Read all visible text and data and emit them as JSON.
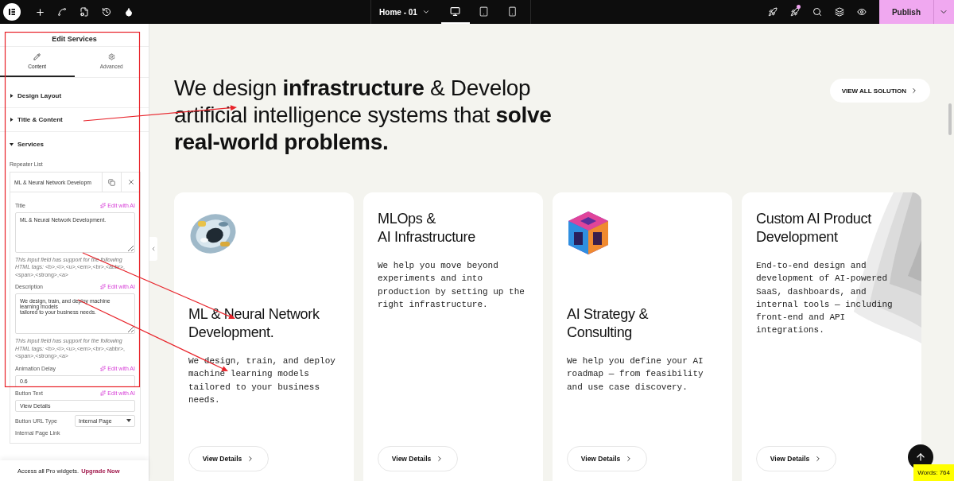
{
  "topbar": {
    "page_title": "Home - 01",
    "devices": [
      {
        "kind": "desktop",
        "selected": true
      },
      {
        "kind": "tablet",
        "selected": false
      },
      {
        "kind": "mobile",
        "selected": false
      }
    ],
    "notification": true,
    "publish": "Publish"
  },
  "panel": {
    "title": "Edit Services",
    "tabs": [
      {
        "label": "Content",
        "kind": "content",
        "selected": true
      },
      {
        "label": "Advanced",
        "kind": "advanced",
        "selected": false
      }
    ],
    "sections": [
      {
        "label": "Design Layout",
        "expanded": false
      },
      {
        "label": "Title & Content",
        "expanded": false
      },
      {
        "label": "Services",
        "expanded": true
      }
    ],
    "repeater": {
      "label": "Repeater List",
      "item_title": "ML & Neural Network Developm",
      "fields": [
        {
          "kind": "textarea",
          "label": "Title",
          "ai_button": "Edit with AI",
          "value": "ML & Neural Network Development.",
          "hint": "*This input field has support for the following HTML tags:* <b>,<i>,<u>,<em>,<br>,<abbr>,<span>,<strong>,<a>"
        },
        {
          "kind": "textarea",
          "label": "Description",
          "ai_button": "Edit with AI",
          "value": "We design, train, and deploy machine learning models\ntailored to your business needs.",
          "hint": "*This input field has support for the following HTML tags:* <b>,<i>,<u>,<em>,<br>,<abbr>,<span>,<strong>,<a>"
        },
        {
          "kind": "text",
          "label": "Animation Delay",
          "ai_button": "Edit with AI",
          "value": "0.6"
        },
        {
          "kind": "text",
          "label": "Button Text",
          "ai_button": "Edit with AI",
          "value": "View Details"
        },
        {
          "kind": "select",
          "label": "Button URL Type",
          "value": "Internal Page"
        },
        {
          "kind": "label",
          "label": "Internal Page Link"
        }
      ]
    },
    "footer": {
      "text": "Access all Pro widgets.",
      "link": "Upgrade Now"
    }
  },
  "hero": {
    "heading": "We design **infrastructure** & Develop artificial intelligence systems that **solve real-world problems.**",
    "button": "VIEW ALL SOLUTION"
  },
  "cards": [
    {
      "kind": "icon-top",
      "title": "ML & Neural Network Development.",
      "body": "We design, train, and deploy machine learning models tailored to your business needs.",
      "button": "View Details"
    },
    {
      "kind": "text",
      "title": "MLOps &\nAI Infrastructure",
      "body": "We help you move beyond experiments and into production by setting up the right infrastructure.",
      "button": "View Details"
    },
    {
      "kind": "icon-top",
      "title": "AI Strategy &\nConsulting",
      "body": "We help you define your AI roadmap — from feasibility and use case discovery.",
      "button": "View Details"
    },
    {
      "kind": "wave-corner",
      "title": "Custom AI Product Development",
      "body": "End-to-end design and development of AI-powered SaaS, dashboards, and internal tools — including front-end and API integrations.",
      "button": "View Details"
    }
  ],
  "word_count": "Words: 764"
}
